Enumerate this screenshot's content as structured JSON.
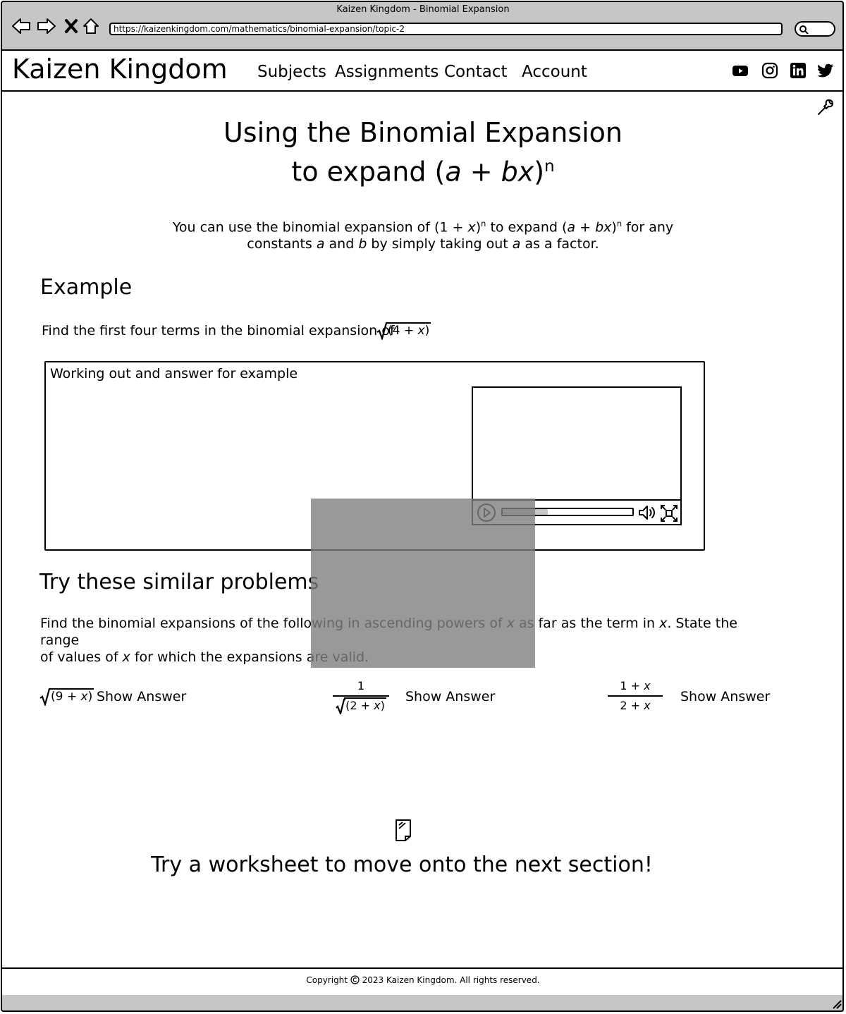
{
  "browser": {
    "window_title": "Kaizen Kingdom - Binomial Expansion",
    "url": "https://kaizenkingdom.com/mathematics/binomial-expansion/topic-2"
  },
  "header": {
    "brand": "Kaizen Kingdom",
    "nav": [
      "Subjects",
      "Assignments",
      "Contact",
      "Account"
    ],
    "social_icons": [
      "youtube-icon",
      "instagram-icon",
      "linkedin-icon",
      "twitter-icon"
    ]
  },
  "main": {
    "title_line1": "Using the Binomial Expansion",
    "title_line2_prefix": "to expand (",
    "title_line2_a": "a",
    "title_line2_mid": " + ",
    "title_line2_bx": "bx",
    "title_line2_suffix": ")",
    "title_line2_exp": "n",
    "intro": {
      "p1": "You can use the binomial expansion of (1 + ",
      "x1": "x",
      "p2": ")",
      "n1": "n",
      "p3": " to expand (",
      "a1": "a",
      "p4": " + ",
      "bx": "bx",
      "p5": ")",
      "n2": "n",
      "p6": " for any",
      "l2a": "constants ",
      "a2": "a",
      "l2b": " and ",
      "b": "b",
      "l2c": " by simply taking out ",
      "a3": "a",
      "l2d": " as a factor."
    },
    "example": {
      "heading": "Example",
      "prompt": "Find the first four terms in the binomial expansion of",
      "radicand_pre": "(4 + ",
      "radicand_x": "x",
      "radicand_post": ")",
      "work_label": "Working out and answer for example"
    },
    "similar": {
      "heading": "Try these similar problems",
      "instr_a": "Find the binomial expansions of the following in ascending powers of ",
      "instr_x1": "x",
      "instr_b": " as far as the term in ",
      "instr_x2": "x",
      "instr_c": ". State the range",
      "instr_d": "of values of ",
      "instr_x3": "x",
      "instr_e": " for which the expansions are valid.",
      "p1_radicand_pre": "(9 + ",
      "p1_radicand_x": "x",
      "p1_radicand_post": ")",
      "p2_num": "1",
      "p2_radicand_pre": "(2 + ",
      "p2_radicand_x": "x",
      "p2_radicand_post": ")",
      "p3_num_pre": "1 + ",
      "p3_num_x": "x",
      "p3_den_pre": "2 + ",
      "p3_den_x": "x",
      "show_answer": "Show Answer"
    },
    "cta": "Try a worksheet to move onto the next section!",
    "video": {
      "progress": 0.35
    }
  },
  "footer": {
    "copyright_pre": "Copyright ",
    "copyright_post": " 2023 Kaizen Kingdom. All rights reserved."
  }
}
